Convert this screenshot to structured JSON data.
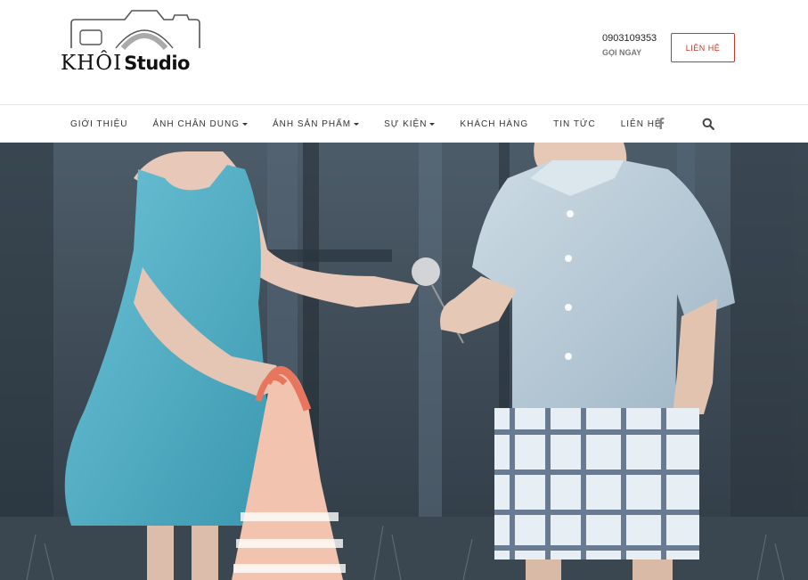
{
  "brand": {
    "logo_khoi": "KHÔI",
    "logo_studio": "Studio"
  },
  "header": {
    "phone": "0903109353",
    "call_now": "GỌI NGAY",
    "contact_button": "LIÊN HỆ"
  },
  "nav": {
    "items": [
      {
        "label": "GIỚI THIỆU",
        "has_dropdown": false
      },
      {
        "label": "ẢNH CHÂN DUNG",
        "has_dropdown": true
      },
      {
        "label": "ẢNH SẢN PHẨM",
        "has_dropdown": true
      },
      {
        "label": "SỰ KIỆN",
        "has_dropdown": true
      },
      {
        "label": "KHÁCH HÀNG",
        "has_dropdown": false
      },
      {
        "label": "TIN TỨC",
        "has_dropdown": false
      },
      {
        "label": "LIÊN HỆ",
        "has_dropdown": false
      }
    ],
    "icons": [
      "facebook-icon",
      "search-icon"
    ]
  },
  "hero": {
    "image": "photo-two-children-flower"
  },
  "colors": {
    "accent": "#c0392b",
    "nav_text": "#333333",
    "hero_wall": "#3d4a55",
    "dress": "#4aa9c0",
    "shirt": "#b8ccd8"
  }
}
